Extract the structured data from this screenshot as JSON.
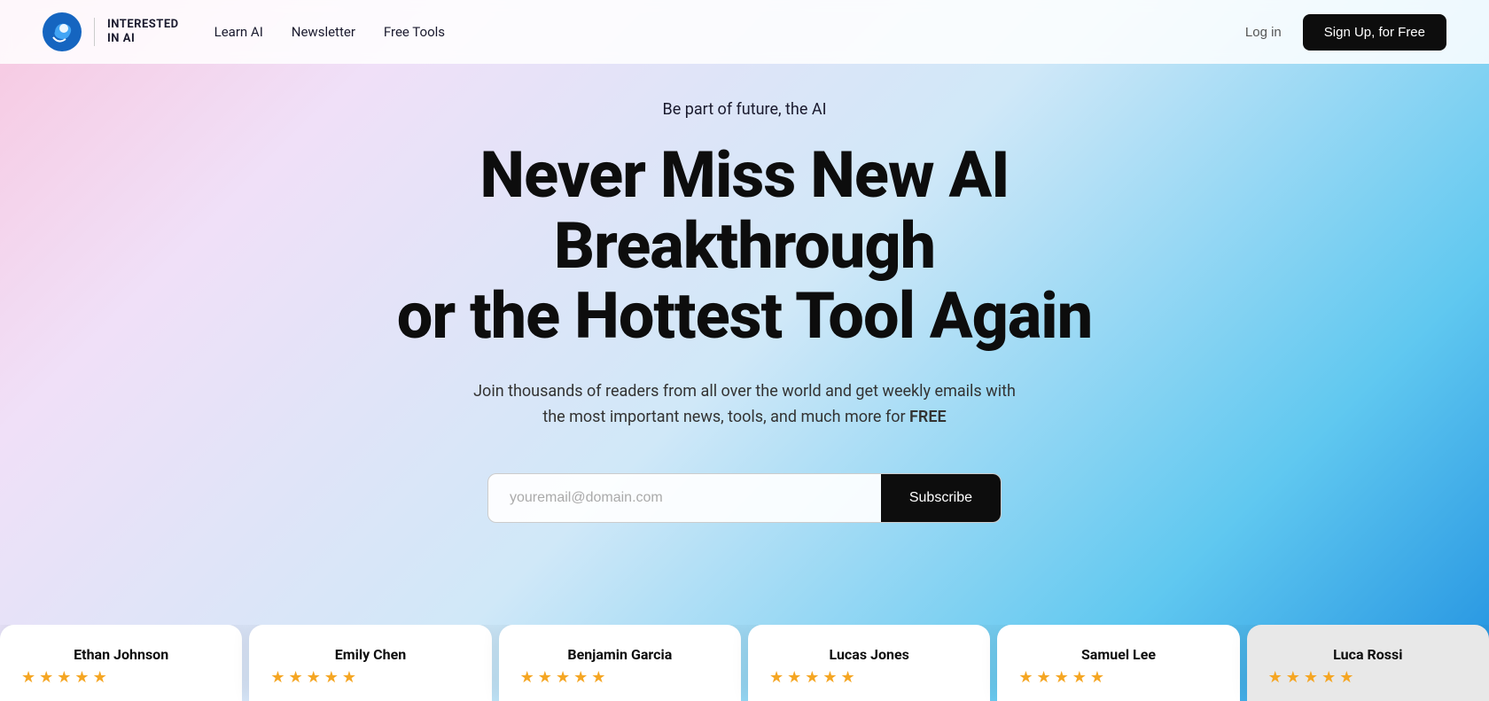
{
  "header": {
    "logo_text_line1": "INTERESTED",
    "logo_text_line2": "IN AI",
    "nav": [
      {
        "label": "Learn AI",
        "id": "learn-ai"
      },
      {
        "label": "Newsletter",
        "id": "newsletter"
      },
      {
        "label": "Free Tools",
        "id": "free-tools"
      }
    ],
    "login_label": "Log in",
    "signup_label": "Sign Up, for Free"
  },
  "hero": {
    "tagline": "Be part of future, the AI",
    "title_line1": "Never Miss New AI Breakthrough",
    "title_line2": "or the Hottest Tool Again",
    "subtitle_before_free": "Join thousands of readers from all over the world and get weekly emails with the most important news, tools, and much more for ",
    "free_word": "FREE",
    "email_placeholder": "youremail@domain.com",
    "subscribe_label": "Subscribe"
  },
  "testimonials": [
    {
      "name": "Ethan Johnson",
      "stars": 5
    },
    {
      "name": "Emily Chen",
      "stars": 5
    },
    {
      "name": "Benjamin Garcia",
      "stars": 5
    },
    {
      "name": "Lucas Jones",
      "stars": 5
    },
    {
      "name": "Samuel Lee",
      "stars": 5
    },
    {
      "name": "Luca Rossi",
      "stars": 5
    }
  ],
  "colors": {
    "accent": "#f5a623",
    "dark": "#0d0d0d",
    "brand_blue": "#2090e0"
  }
}
